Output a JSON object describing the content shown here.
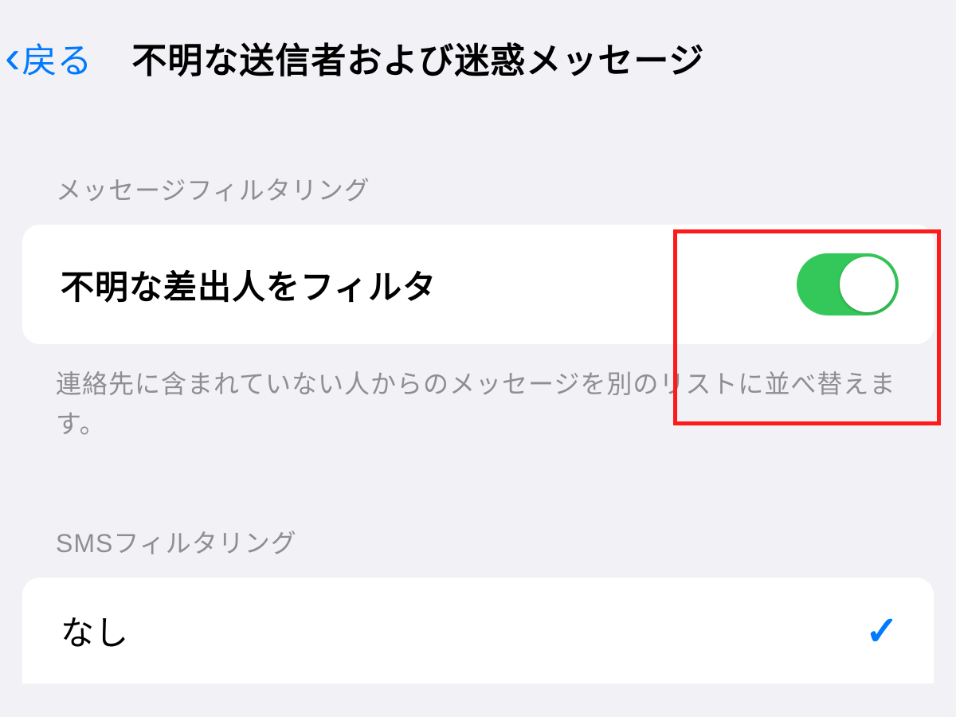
{
  "nav": {
    "back_label": "戻る",
    "title": "不明な送信者および迷惑メッセージ"
  },
  "section1": {
    "header": "メッセージフィルタリング",
    "row_label": "不明な差出人をフィルタ",
    "toggle_on": true,
    "footer": "連絡先に含まれていない人からのメッセージを別のリストに並べ替えます。"
  },
  "section2": {
    "header": "SMSフィルタリング",
    "row_label": "なし",
    "selected": true
  },
  "colors": {
    "accent_blue": "#007aff",
    "toggle_green": "#34c759",
    "highlight_red": "#ff1a1a",
    "bg": "#f2f1f6"
  }
}
